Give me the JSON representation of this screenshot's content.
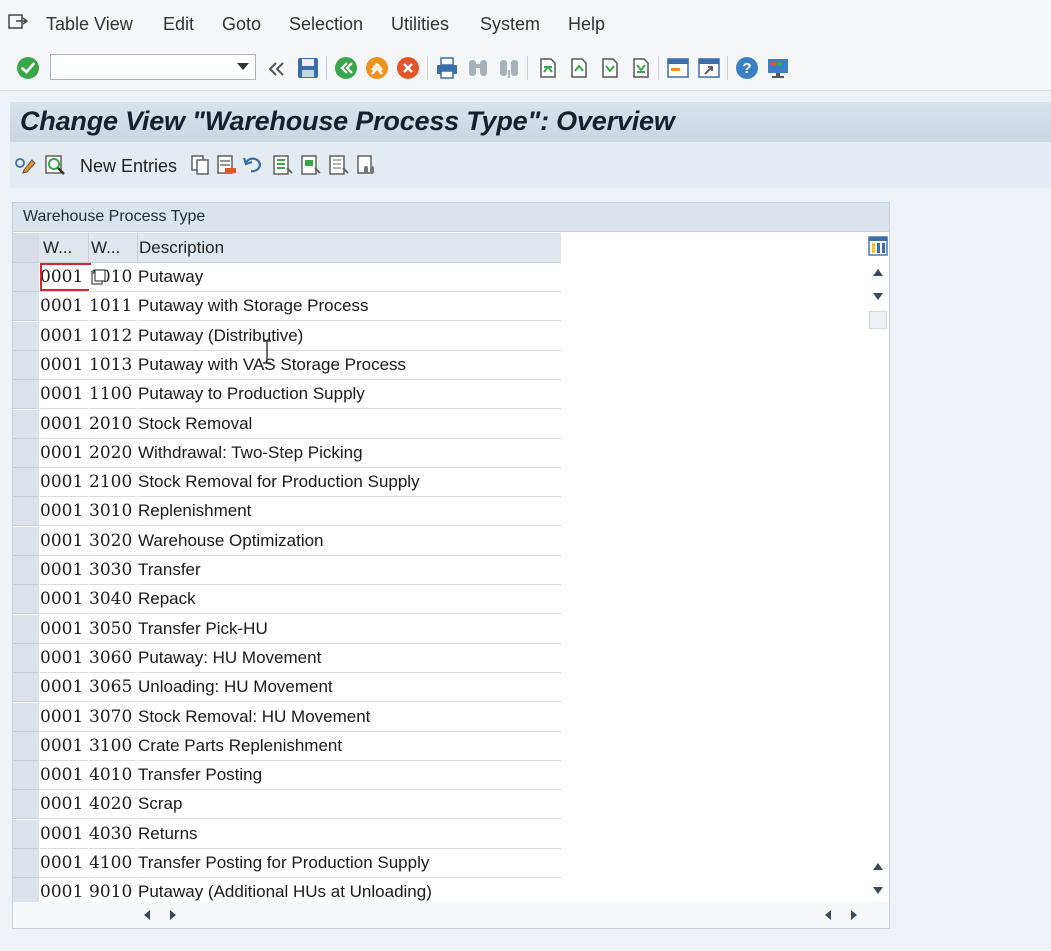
{
  "menubar": {
    "items": [
      "Table View",
      "Edit",
      "Goto",
      "Selection",
      "Utilities",
      "System",
      "Help"
    ]
  },
  "command_field": {
    "value": ""
  },
  "title": "Change View \"Warehouse Process Type\": Overview",
  "app_toolbar": {
    "new_entries_label": "New Entries"
  },
  "table": {
    "caption": "Warehouse Process Type",
    "columns": [
      "W...",
      "W...",
      "Description"
    ],
    "rows": [
      {
        "wh": "0001",
        "pt": "1010",
        "desc": "Putaway"
      },
      {
        "wh": "0001",
        "pt": "1011",
        "desc": "Putaway with Storage Process"
      },
      {
        "wh": "0001",
        "pt": "1012",
        "desc": "Putaway (Distributive)"
      },
      {
        "wh": "0001",
        "pt": "1013",
        "desc": "Putaway with VAS Storage Process"
      },
      {
        "wh": "0001",
        "pt": "1100",
        "desc": "Putaway to Production Supply"
      },
      {
        "wh": "0001",
        "pt": "2010",
        "desc": "Stock Removal"
      },
      {
        "wh": "0001",
        "pt": "2020",
        "desc": "Withdrawal: Two-Step Picking"
      },
      {
        "wh": "0001",
        "pt": "2100",
        "desc": "Stock Removal for Production Supply"
      },
      {
        "wh": "0001",
        "pt": "3010",
        "desc": "Replenishment"
      },
      {
        "wh": "0001",
        "pt": "3020",
        "desc": "Warehouse Optimization"
      },
      {
        "wh": "0001",
        "pt": "3030",
        "desc": "Transfer"
      },
      {
        "wh": "0001",
        "pt": "3040",
        "desc": "Repack"
      },
      {
        "wh": "0001",
        "pt": "3050",
        "desc": "Transfer Pick-HU"
      },
      {
        "wh": "0001",
        "pt": "3060",
        "desc": "Putaway: HU Movement"
      },
      {
        "wh": "0001",
        "pt": "3065",
        "desc": "Unloading: HU Movement"
      },
      {
        "wh": "0001",
        "pt": "3070",
        "desc": "Stock Removal: HU Movement"
      },
      {
        "wh": "0001",
        "pt": "3100",
        "desc": "Crate Parts Replenishment"
      },
      {
        "wh": "0001",
        "pt": "4010",
        "desc": "Transfer Posting"
      },
      {
        "wh": "0001",
        "pt": "4020",
        "desc": "Scrap"
      },
      {
        "wh": "0001",
        "pt": "4030",
        "desc": "Returns"
      },
      {
        "wh": "0001",
        "pt": "4100",
        "desc": "Transfer Posting for Production Supply"
      },
      {
        "wh": "0001",
        "pt": "9010",
        "desc": "Putaway (Additional HUs at Unloading)"
      }
    ]
  },
  "colors": {
    "accent_green": "#3aa64a",
    "accent_orange": "#f0921e",
    "accent_blue": "#3b7fc4",
    "focus_red": "#dd2233"
  }
}
